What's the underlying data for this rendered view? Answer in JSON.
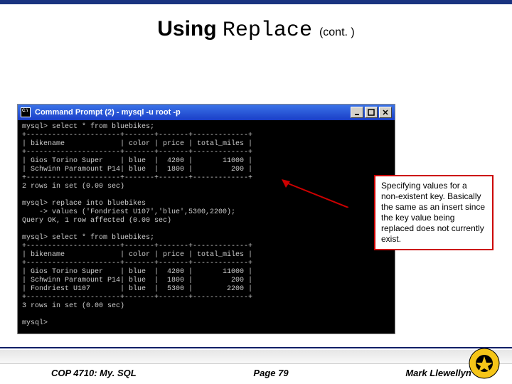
{
  "title": {
    "prefix": "Using ",
    "code": "Replace",
    "cont": "(cont. )"
  },
  "terminal": {
    "window_title": "Command Prompt (2) - mysql -u root -p",
    "lines": [
      "mysql> select * from bluebikes;",
      "+----------------------+-------+-------+-------------+",
      "| bikename             | color | price | total_miles |",
      "+----------------------+-------+-------+-------------+",
      "| Gios Torino Super    | blue  |  4200 |       11000 |",
      "| Schwinn Paramount P14| blue  |  1800 |         200 |",
      "+----------------------+-------+-------+-------------+",
      "2 rows in set (0.00 sec)",
      "",
      "mysql> replace into bluebikes",
      "    -> values ('Fondriest U107','blue',5300,2200);",
      "Query OK, 1 row affected (0.00 sec)",
      "",
      "mysql> select * from bluebikes;",
      "+----------------------+-------+-------+-------------+",
      "| bikename             | color | price | total_miles |",
      "+----------------------+-------+-------+-------------+",
      "| Gios Torino Super    | blue  |  4200 |       11000 |",
      "| Schwinn Paramount P14| blue  |  1800 |         200 |",
      "| Fondriest U107       | blue  |  5300 |        2200 |",
      "+----------------------+-------+-------+-------------+",
      "3 rows in set (0.00 sec)",
      "",
      "mysql>"
    ]
  },
  "callout": "Specifying values for a non-existent key. Basically the same as an insert since the key value being replaced does not currently exist.",
  "footer": {
    "left": "COP 4710: My. SQL",
    "mid": "Page 79",
    "right": "Mark Llewellyn ©"
  }
}
